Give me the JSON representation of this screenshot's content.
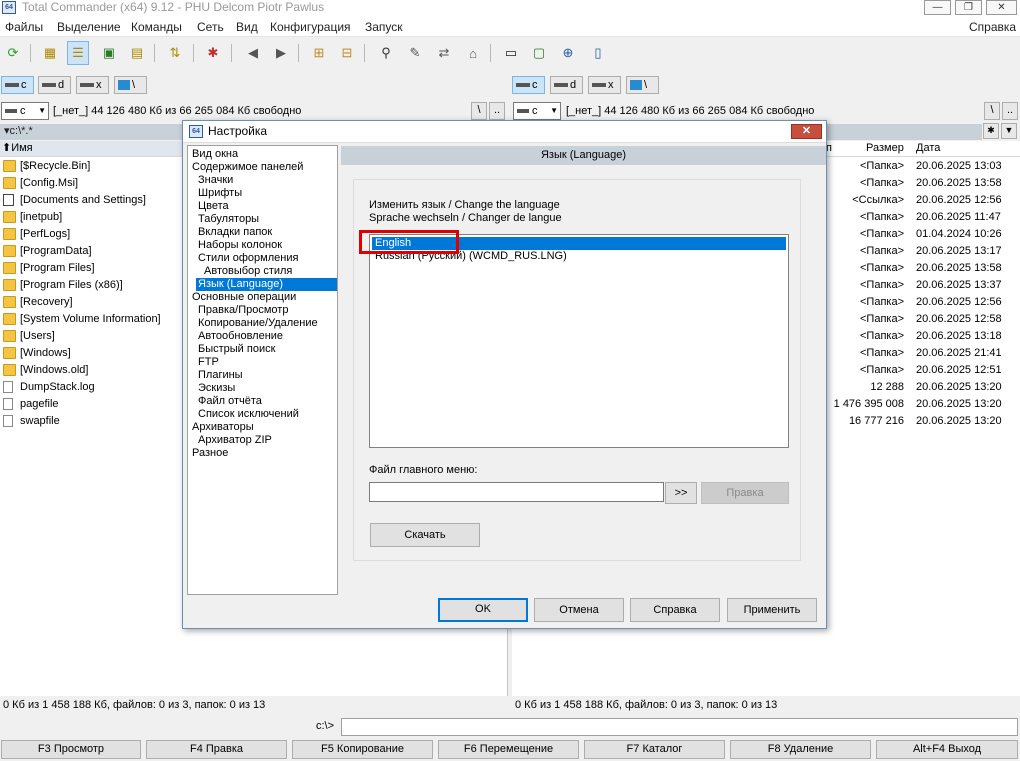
{
  "titlebar": {
    "title": "Total Commander (x64) 9.12 - PHU Delcom Piotr Pawlus",
    "min": "—",
    "max": "❐",
    "close": "✕"
  },
  "menu": {
    "items": [
      "Файлы",
      "Выделение",
      "Команды",
      "Сеть",
      "Вид",
      "Конфигурация",
      "Запуск"
    ],
    "help": "Справка"
  },
  "drives": {
    "left": [
      "c",
      "d",
      "x",
      "\\"
    ],
    "right": [
      "c",
      "d",
      "x",
      "\\"
    ]
  },
  "left": {
    "drive": "c",
    "info": "[_нет_]  44 126 480 Кб из 66 265 084 Кб свободно",
    "root_btn": "\\",
    "up_btn": "..",
    "path": "▾c:\\*.*",
    "col_name": "⬆Имя",
    "files": [
      "[$Recycle.Bin]",
      "[Config.Msi]",
      "[Documents and Settings]",
      "[inetpub]",
      "[PerfLogs]",
      "[ProgramData]",
      "[Program Files]",
      "[Program Files (x86)]",
      "[Recovery]",
      "[System Volume Information]",
      "[Users]",
      "[Windows]",
      "[Windows.old]",
      "DumpStack.log",
      "pagefile",
      "swapfile"
    ],
    "status": "0 Кб из 1 458 188 Кб, файлов: 0 из 3, папок: 0 из 13"
  },
  "right": {
    "drive": "c",
    "info": "[_нет_]  44 126 480 Кб из 66 265 084 Кб свободно",
    "root_btn": "\\",
    "up_btn": "..",
    "star": "✱",
    "dropdown": "▼",
    "col_ext": "п",
    "col_size": "Размер",
    "col_date": "Дата",
    "rows": [
      {
        "size": "<Папка>",
        "date": "20.06.2025 13:03"
      },
      {
        "size": "<Папка>",
        "date": "20.06.2025 13:58"
      },
      {
        "size": "<Ссылка>",
        "date": "20.06.2025 12:56"
      },
      {
        "size": "<Папка>",
        "date": "20.06.2025 11:47"
      },
      {
        "size": "<Папка>",
        "date": "01.04.2024 10:26"
      },
      {
        "size": "<Папка>",
        "date": "20.06.2025 13:17"
      },
      {
        "size": "<Папка>",
        "date": "20.06.2025 13:58"
      },
      {
        "size": "<Папка>",
        "date": "20.06.2025 13:37"
      },
      {
        "size": "<Папка>",
        "date": "20.06.2025 12:56"
      },
      {
        "size": "<Папка>",
        "date": "20.06.2025 12:58"
      },
      {
        "size": "<Папка>",
        "date": "20.06.2025 13:18"
      },
      {
        "size": "<Папка>",
        "date": "20.06.2025 21:41"
      },
      {
        "size": "<Папка>",
        "date": "20.06.2025 12:51"
      },
      {
        "size": "12 288",
        "date": "20.06.2025 13:20"
      },
      {
        "size": "1 476 395 008",
        "date": "20.06.2025 13:20"
      },
      {
        "size": "16 777 216",
        "date": "20.06.2025 13:20"
      }
    ],
    "status": "0 Кб из 1 458 188 Кб, файлов: 0 из 3, папок: 0 из 13"
  },
  "cmdline": {
    "prompt": "c:\\>",
    "value": ""
  },
  "fkeys": [
    "F3 Просмотр",
    "F4 Правка",
    "F5 Копирование",
    "F6 Перемещение",
    "F7 Каталог",
    "F8 Удаление",
    "Alt+F4 Выход"
  ],
  "dialog": {
    "title": "Настройка",
    "close": "✕",
    "nav": [
      {
        "label": "Вид окна",
        "indent": 0
      },
      {
        "label": "Содержимое панелей",
        "indent": 0
      },
      {
        "label": "Значки",
        "indent": 1
      },
      {
        "label": "Шрифты",
        "indent": 1
      },
      {
        "label": "Цвета",
        "indent": 1
      },
      {
        "label": "Табуляторы",
        "indent": 1
      },
      {
        "label": "Вкладки папок",
        "indent": 1
      },
      {
        "label": "Наборы колонок",
        "indent": 1
      },
      {
        "label": "Стили оформления",
        "indent": 1
      },
      {
        "label": "Автовыбор стиля",
        "indent": 2
      },
      {
        "label": "Язык (Language)",
        "indent": 1,
        "selected": true
      },
      {
        "label": "Основные операции",
        "indent": 0
      },
      {
        "label": "Правка/Просмотр",
        "indent": 1
      },
      {
        "label": "Копирование/Удаление",
        "indent": 1
      },
      {
        "label": "Автообновление",
        "indent": 1
      },
      {
        "label": "Быстрый поиск",
        "indent": 1
      },
      {
        "label": "FTP",
        "indent": 1
      },
      {
        "label": "Плагины",
        "indent": 1
      },
      {
        "label": "Эскизы",
        "indent": 1
      },
      {
        "label": "Файл отчёта",
        "indent": 1
      },
      {
        "label": "Список исключений",
        "indent": 1
      },
      {
        "label": "Архиваторы",
        "indent": 0
      },
      {
        "label": "Архиватор ZIP",
        "indent": 1
      },
      {
        "label": "Разное",
        "indent": 0
      }
    ],
    "page_header": "Язык (Language)",
    "change_lang_1": "Изменить язык / Change the language",
    "change_lang_2": "Sprache wechseln / Changer de langue",
    "languages": [
      {
        "label": "English",
        "selected": true
      },
      {
        "label": "Russian (Русский) (WCMD_RUS.LNG)",
        "selected": false
      }
    ],
    "menu_file_label": "Файл главного меню:",
    "menu_file_value": "",
    "browse_btn": ">>",
    "edit_btn": "Правка",
    "download_btn": "Скачать",
    "ok_btn": "OK",
    "cancel_btn": "Отмена",
    "help_btn": "Справка",
    "apply_btn": "Применить",
    "highlight_color": "#e00000",
    "accent": "#0078d7"
  }
}
